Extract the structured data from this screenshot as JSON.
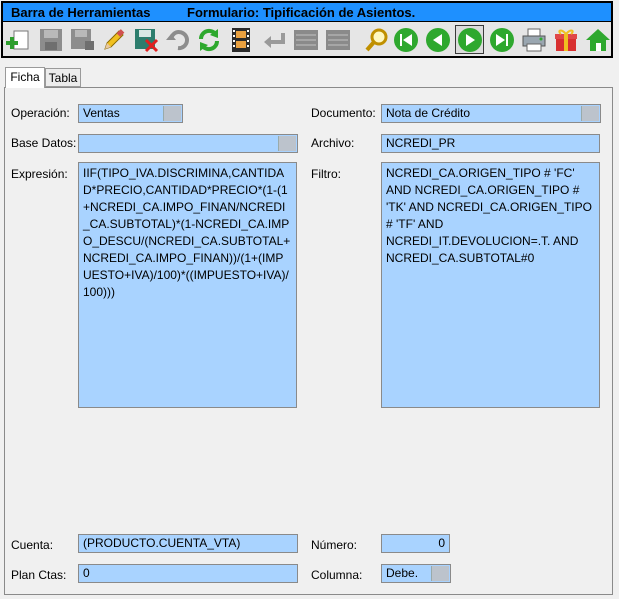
{
  "toolbar": {
    "title": "Barra de Herramientas",
    "form_title": "Formulario: Tipificación de Asientos.",
    "icons": [
      "add-icon",
      "save-icon",
      "save-all-icon",
      "edit-icon",
      "delete-save-icon",
      "undo-icon",
      "refresh-icon",
      "film-icon",
      "return-icon",
      "list-icon",
      "list-icon",
      "search-icon",
      "first-record-icon",
      "previous-record-icon",
      "next-record-icon",
      "last-record-icon",
      "print-icon",
      "gift-icon",
      "home-icon"
    ]
  },
  "tabs": {
    "ficha": "Ficha",
    "tabla": "Tabla"
  },
  "form": {
    "operacion_label": "Operación:",
    "operacion_value": "Ventas",
    "documento_label": "Documento:",
    "documento_value": "Nota de Crédito",
    "base_datos_label": "Base Datos:",
    "base_datos_value": "",
    "archivo_label": "Archivo:",
    "archivo_value": "NCREDI_PR",
    "expresion_label": "Expresión:",
    "expresion_value": "IIF(TIPO_IVA.DISCRIMINA,CANTIDAD*PRECIO,CANTIDAD*PRECIO*(1-(1+NCREDI_CA.IMPO_FINAN/NCREDI_CA.SUBTOTAL)*(1-NCREDI_CA.IMPO_DESCU/(NCREDI_CA.SUBTOTAL+NCREDI_CA.IMPO_FINAN))/(1+(IMPUESTO+IVA)/100)*((IMPUESTO+IVA)/100)))",
    "filtro_label": "Filtro:",
    "filtro_value": "NCREDI_CA.ORIGEN_TIPO # 'FC' AND NCREDI_CA.ORIGEN_TIPO # 'TK' AND NCREDI_CA.ORIGEN_TIPO # 'TF' AND NCREDI_IT.DEVOLUCION=.T. AND NCREDI_CA.SUBTOTAL#0",
    "cuenta_label": "Cuenta:",
    "cuenta_value": "(PRODUCTO.CUENTA_VTA)",
    "numero_label": "Número:",
    "numero_value": "0",
    "plan_ctas_label": "Plan Ctas:",
    "plan_ctas_value": "0",
    "columna_label": "Columna:",
    "columna_value": "Debe."
  }
}
